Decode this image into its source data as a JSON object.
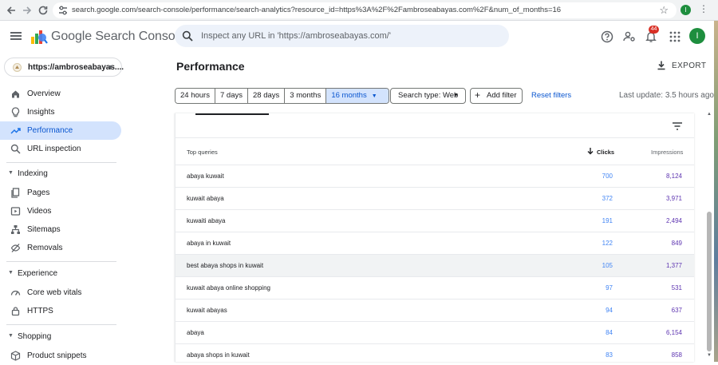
{
  "browser": {
    "url": "search.google.com/search-console/performance/search-analytics?resource_id=https%3A%2F%2Fambroseabayas.com%2F&num_of_months=16",
    "profile_initial": "I"
  },
  "header": {
    "product_name": "Google Search Console",
    "search_placeholder": "Inspect any URL in 'https://ambroseabayas.com/'",
    "notification_count": "44",
    "account_initial": "I"
  },
  "sidebar": {
    "property": "https://ambroseabayas....",
    "items_top": [
      {
        "label": "Overview",
        "icon": "home-icon"
      },
      {
        "label": "Insights",
        "icon": "insights-icon"
      },
      {
        "label": "Performance",
        "icon": "trending-up-icon",
        "active": true
      },
      {
        "label": "URL inspection",
        "icon": "search-icon"
      }
    ],
    "section_indexing": "Indexing",
    "items_indexing": [
      {
        "label": "Pages",
        "icon": "pages-icon"
      },
      {
        "label": "Videos",
        "icon": "videos-icon"
      },
      {
        "label": "Sitemaps",
        "icon": "sitemaps-icon"
      },
      {
        "label": "Removals",
        "icon": "removals-icon"
      }
    ],
    "section_experience": "Experience",
    "items_experience": [
      {
        "label": "Core web vitals",
        "icon": "speed-icon"
      },
      {
        "label": "HTTPS",
        "icon": "lock-icon"
      }
    ],
    "section_shopping": "Shopping",
    "items_shopping": [
      {
        "label": "Product snippets",
        "icon": "product-icon"
      }
    ]
  },
  "main": {
    "title": "Performance",
    "export_label": "EXPORT",
    "date_ranges": [
      "24 hours",
      "7 days",
      "28 days",
      "3 months",
      "16 months"
    ],
    "active_range": "16 months",
    "search_type": "Search type: Web",
    "add_filter": "Add filter",
    "reset_filters": "Reset filters",
    "last_update": "Last update: 3.5 hours ago"
  },
  "table": {
    "headers": {
      "query": "Top queries",
      "clicks": "Clicks",
      "impressions": "Impressions"
    },
    "rows": [
      {
        "query": "abaya kuwait",
        "clicks": "700",
        "impressions": "8,124"
      },
      {
        "query": "kuwait abaya",
        "clicks": "372",
        "impressions": "3,971"
      },
      {
        "query": "kuwaiti abaya",
        "clicks": "191",
        "impressions": "2,494"
      },
      {
        "query": "abaya in kuwait",
        "clicks": "122",
        "impressions": "849"
      },
      {
        "query": "best abaya shops in kuwait",
        "clicks": "105",
        "impressions": "1,377"
      },
      {
        "query": "kuwait abaya online shopping",
        "clicks": "97",
        "impressions": "531"
      },
      {
        "query": "kuwait abayas",
        "clicks": "94",
        "impressions": "637"
      },
      {
        "query": "abaya",
        "clicks": "84",
        "impressions": "6,154"
      },
      {
        "query": "abaya shops in kuwait",
        "clicks": "83",
        "impressions": "858"
      }
    ]
  },
  "colors": {
    "accent_blue": "#1a73e8",
    "active_nav_bg": "#d3e3fd",
    "clicks_blue": "#4285f4",
    "impressions_purple": "#5e35b1",
    "badge_red": "#d93025"
  }
}
